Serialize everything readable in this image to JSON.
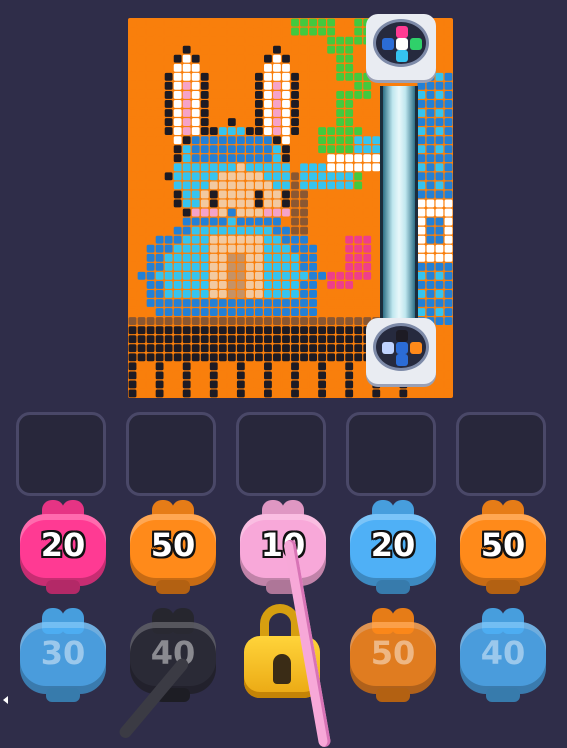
{
  "colors": {
    "background": "#2f2d49",
    "board_orange": "#f97f0c",
    "pink": "#ff3a93",
    "orange": "#ff8a1a",
    "light_pink": "#f8a8d9",
    "blue": "#4fb0f6",
    "black": "#2a2a33",
    "gold": "#f8c22a"
  },
  "board": {
    "subject": "bunny-hood pixel art",
    "pixel_palette": {
      "O": "#f97f0c",
      "G": "#43c93e",
      "W": "#ffffff",
      "P": "#f5a3c8",
      "K": "#1d1b24",
      "C": "#35c4f0",
      "B": "#2380d6",
      "T": "#f2c9a0",
      "t": "#c69265",
      "M": "#e65aa0",
      "D": "#8a5732",
      "R": "#ee3f8a"
    }
  },
  "slots": [
    {
      "state": "empty"
    },
    {
      "state": "empty"
    },
    {
      "state": "empty"
    },
    {
      "state": "empty"
    },
    {
      "state": "empty"
    }
  ],
  "shooters_row1": [
    {
      "color": "pink",
      "ammo": "20"
    },
    {
      "color": "orange",
      "ammo": "50"
    },
    {
      "color": "light_pink",
      "ammo": "10"
    },
    {
      "color": "blue",
      "ammo": "20"
    },
    {
      "color": "orange",
      "ammo": "50"
    }
  ],
  "shooters_row2": [
    {
      "color": "blue",
      "ammo": "30"
    },
    {
      "color": "black",
      "ammo": "40"
    },
    {
      "color": "gold",
      "ammo": "",
      "locked": true
    },
    {
      "color": "orange",
      "ammo": "50"
    },
    {
      "color": "blue",
      "ammo": "40"
    }
  ]
}
